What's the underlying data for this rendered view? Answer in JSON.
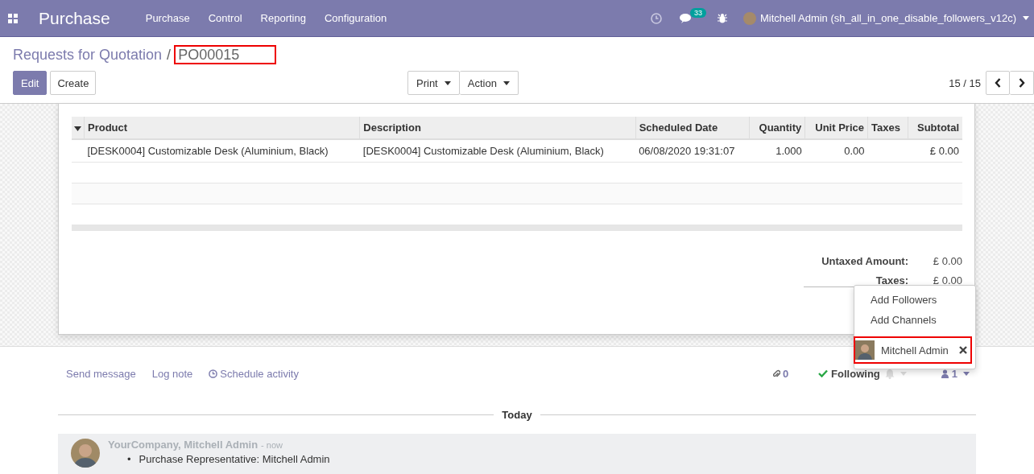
{
  "navbar": {
    "app_title": "Purchase",
    "menu": [
      "Purchase",
      "Control",
      "Reporting",
      "Configuration"
    ],
    "chat_count": "33",
    "user": "Mitchell Admin (sh_all_in_one_disable_followers_v12c)"
  },
  "breadcrumb": {
    "parent": "Requests for Quotation",
    "separator": "/",
    "current": "PO00015",
    "highlighted": true
  },
  "buttons": [
    "Edit",
    "Create"
  ],
  "actions": [
    "Print",
    "Action"
  ],
  "pager": "15 / 15",
  "table": {
    "columns": [
      {
        "label": "Product",
        "kind": "text"
      },
      {
        "label": "Description",
        "kind": "text"
      },
      {
        "label": "Scheduled Date",
        "kind": "text"
      },
      {
        "label": "Quantity",
        "kind": "number"
      },
      {
        "label": "Unit Price",
        "kind": "number"
      },
      {
        "label": "Taxes",
        "kind": "text"
      },
      {
        "label": "Subtotal",
        "kind": "number"
      }
    ],
    "rows": [
      {
        "cells": [
          "[DESK0004] Customizable Desk (Aluminium, Black)",
          "[DESK0004] Customizable Desk (Aluminium, Black)",
          "06/08/2020 19:31:07",
          "1.000",
          "0.00",
          "",
          "£ 0.00"
        ]
      }
    ]
  },
  "totals": [
    {
      "label": "Untaxed Amount:",
      "value": "£ 0.00"
    },
    {
      "label": "Taxes:",
      "value": "£ 0.00"
    }
  ],
  "chatter": {
    "actions": [
      "Send message",
      "Log note",
      "Schedule activity"
    ],
    "attachments": "0",
    "following": "Following",
    "followers_count": "1",
    "followers_menu": {
      "items": [
        "Add Followers",
        "Add Channels"
      ],
      "followers": [
        {
          "name": "Mitchell Admin",
          "highlighted": true
        }
      ]
    },
    "date_separator": "Today",
    "messages": [
      {
        "author": "YourCompany, Mitchell Admin",
        "time": "- now",
        "changes": [
          {
            "bullet": "•",
            "text": "Purchase Representative: Mitchell Admin"
          }
        ]
      }
    ]
  }
}
